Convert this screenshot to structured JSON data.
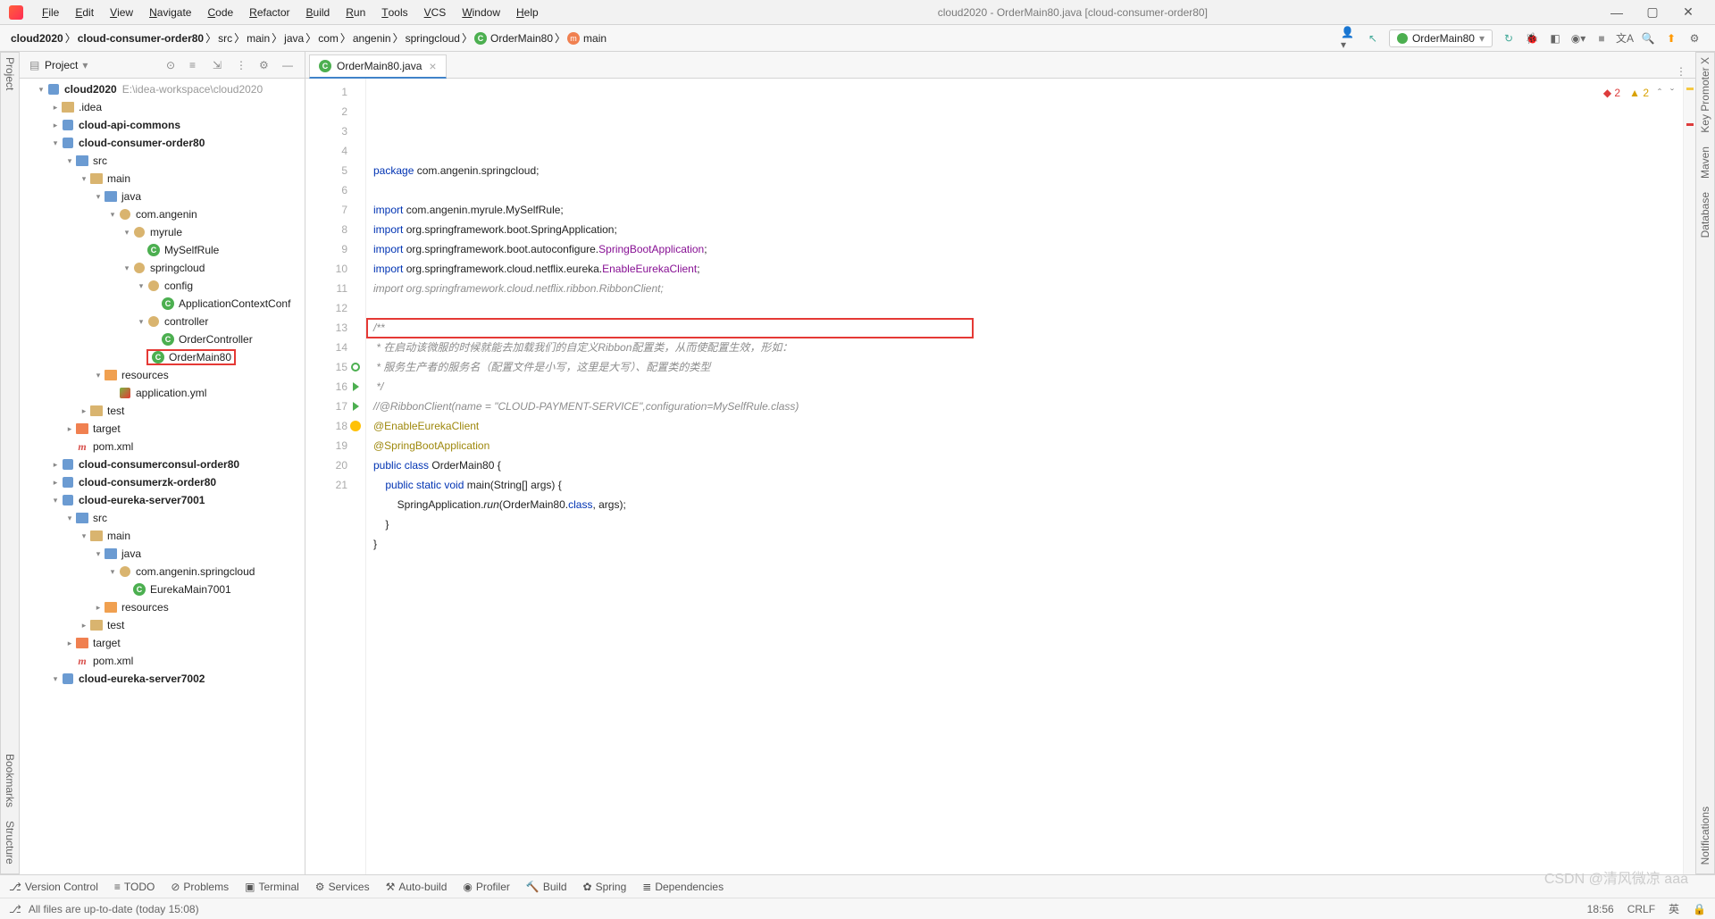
{
  "window": {
    "title": "cloud2020 - OrderMain80.java [cloud-consumer-order80]"
  },
  "menu": [
    "File",
    "Edit",
    "View",
    "Navigate",
    "Code",
    "Refactor",
    "Build",
    "Run",
    "Tools",
    "VCS",
    "Window",
    "Help"
  ],
  "breadcrumbs": [
    {
      "label": "cloud2020",
      "bold": true
    },
    {
      "label": "cloud-consumer-order80",
      "bold": true
    },
    {
      "label": "src"
    },
    {
      "label": "main"
    },
    {
      "label": "java"
    },
    {
      "label": "com"
    },
    {
      "label": "angenin"
    },
    {
      "label": "springcloud"
    },
    {
      "label": "OrderMain80",
      "icon": "class"
    },
    {
      "label": "main",
      "icon": "method"
    }
  ],
  "run_config": "OrderMain80",
  "project_panel": {
    "title": "Project"
  },
  "tree": [
    {
      "d": 0,
      "a": "v",
      "i": "module",
      "n": "cloud2020",
      "b": true,
      "p": "E:\\idea-workspace\\cloud2020"
    },
    {
      "d": 1,
      "a": ">",
      "i": "folder",
      "n": ".idea"
    },
    {
      "d": 1,
      "a": ">",
      "i": "module",
      "n": "cloud-api-commons",
      "b": true
    },
    {
      "d": 1,
      "a": "v",
      "i": "module",
      "n": "cloud-consumer-order80",
      "b": true
    },
    {
      "d": 2,
      "a": "v",
      "i": "folder-blue",
      "n": "src"
    },
    {
      "d": 3,
      "a": "v",
      "i": "folder",
      "n": "main"
    },
    {
      "d": 4,
      "a": "v",
      "i": "folder-blue",
      "n": "java"
    },
    {
      "d": 5,
      "a": "v",
      "i": "pkg",
      "n": "com.angenin"
    },
    {
      "d": 6,
      "a": "v",
      "i": "pkg",
      "n": "myrule"
    },
    {
      "d": 7,
      "a": "",
      "i": "class",
      "n": "MySelfRule"
    },
    {
      "d": 6,
      "a": "v",
      "i": "pkg",
      "n": "springcloud"
    },
    {
      "d": 7,
      "a": "v",
      "i": "pkg",
      "n": "config"
    },
    {
      "d": 8,
      "a": "",
      "i": "class",
      "n": "ApplicationContextConf"
    },
    {
      "d": 7,
      "a": "v",
      "i": "pkg",
      "n": "controller"
    },
    {
      "d": 8,
      "a": "",
      "i": "class",
      "n": "OrderController"
    },
    {
      "d": 7,
      "a": "",
      "i": "class",
      "n": "OrderMain80",
      "red": true
    },
    {
      "d": 4,
      "a": "v",
      "i": "folder-orange",
      "n": "resources"
    },
    {
      "d": 5,
      "a": "",
      "i": "yml",
      "n": "application.yml"
    },
    {
      "d": 3,
      "a": ">",
      "i": "folder",
      "n": "test"
    },
    {
      "d": 2,
      "a": ">",
      "i": "folder-excl",
      "n": "target"
    },
    {
      "d": 2,
      "a": "",
      "i": "mvn",
      "n": "pom.xml"
    },
    {
      "d": 1,
      "a": ">",
      "i": "module",
      "n": "cloud-consumerconsul-order80",
      "b": true
    },
    {
      "d": 1,
      "a": ">",
      "i": "module",
      "n": "cloud-consumerzk-order80",
      "b": true
    },
    {
      "d": 1,
      "a": "v",
      "i": "module",
      "n": "cloud-eureka-server7001",
      "b": true
    },
    {
      "d": 2,
      "a": "v",
      "i": "folder-blue",
      "n": "src"
    },
    {
      "d": 3,
      "a": "v",
      "i": "folder",
      "n": "main"
    },
    {
      "d": 4,
      "a": "v",
      "i": "folder-blue",
      "n": "java"
    },
    {
      "d": 5,
      "a": "v",
      "i": "pkg",
      "n": "com.angenin.springcloud"
    },
    {
      "d": 6,
      "a": "",
      "i": "class",
      "n": "EurekaMain7001"
    },
    {
      "d": 4,
      "a": ">",
      "i": "folder-orange",
      "n": "resources"
    },
    {
      "d": 3,
      "a": ">",
      "i": "folder",
      "n": "test"
    },
    {
      "d": 2,
      "a": ">",
      "i": "folder-excl",
      "n": "target"
    },
    {
      "d": 2,
      "a": "",
      "i": "mvn",
      "n": "pom.xml"
    },
    {
      "d": 1,
      "a": "v",
      "i": "module",
      "n": "cloud-eureka-server7002",
      "b": true
    }
  ],
  "tab": {
    "label": "OrderMain80.java"
  },
  "inspections": {
    "errors": "2",
    "warnings": "2"
  },
  "code_lines": [
    {
      "n": 1,
      "seg": [
        {
          "t": "package ",
          "c": "kw"
        },
        {
          "t": "com.angenin.springcloud;"
        }
      ]
    },
    {
      "n": 2,
      "seg": []
    },
    {
      "n": 3,
      "seg": [
        {
          "t": "import ",
          "c": "kw"
        },
        {
          "t": "com.angenin.myrule.MySelfRule;"
        }
      ]
    },
    {
      "n": 4,
      "seg": [
        {
          "t": "import ",
          "c": "kw"
        },
        {
          "t": "org.springframework.boot.SpringApplication;"
        }
      ]
    },
    {
      "n": 5,
      "seg": [
        {
          "t": "import ",
          "c": "kw"
        },
        {
          "t": "org.springframework.boot.autoconfigure."
        },
        {
          "t": "SpringBootApplication",
          "c": "used"
        },
        {
          "t": ";"
        }
      ]
    },
    {
      "n": 6,
      "seg": [
        {
          "t": "import ",
          "c": "kw"
        },
        {
          "t": "org.springframework.cloud.netflix.eureka."
        },
        {
          "t": "EnableEurekaClient",
          "c": "used"
        },
        {
          "t": ";"
        }
      ]
    },
    {
      "n": 7,
      "seg": [
        {
          "t": "import org.springframework.cloud.netflix.ribbon.RibbonClient;",
          "c": "com"
        }
      ]
    },
    {
      "n": 8,
      "seg": []
    },
    {
      "n": 9,
      "seg": [
        {
          "t": "/**",
          "c": "doc"
        }
      ]
    },
    {
      "n": 10,
      "seg": [
        {
          "t": " * 在启动该微服的时候就能去加载我们的自定义Ribbon配置类，从而使配置生效，形如：",
          "c": "doc"
        }
      ]
    },
    {
      "n": 11,
      "seg": [
        {
          "t": " * 服务生产者的服务名（配置文件是小写，这里是大写）、配置类的类型",
          "c": "doc"
        }
      ]
    },
    {
      "n": 12,
      "seg": [
        {
          "t": " */",
          "c": "doc"
        }
      ]
    },
    {
      "n": 13,
      "seg": [
        {
          "t": "//@RibbonClient(name = \"CLOUD-PAYMENT-SERVICE\",configuration=MySelfRule.class)",
          "c": "com"
        }
      ]
    },
    {
      "n": 14,
      "seg": [
        {
          "t": "@EnableEurekaClient",
          "c": "ann"
        }
      ]
    },
    {
      "n": 15,
      "seg": [
        {
          "t": "@SpringBootApplication",
          "c": "ann"
        }
      ]
    },
    {
      "n": 16,
      "seg": [
        {
          "t": "public class ",
          "c": "kw"
        },
        {
          "t": "OrderMain80"
        },
        {
          "t": " {"
        }
      ]
    },
    {
      "n": 17,
      "seg": [
        {
          "t": "    "
        },
        {
          "t": "public static void ",
          "c": "kw"
        },
        {
          "t": "main"
        },
        {
          "t": "(String[] args) {"
        }
      ]
    },
    {
      "n": 18,
      "seg": [
        {
          "t": "        SpringApplication."
        },
        {
          "t": "run",
          "c": "mtd"
        },
        {
          "t": "(OrderMain80."
        },
        {
          "t": "class",
          "c": "kw"
        },
        {
          "t": ", args);"
        }
      ]
    },
    {
      "n": 19,
      "seg": [
        {
          "t": "    }"
        }
      ]
    },
    {
      "n": 20,
      "seg": [
        {
          "t": "}"
        }
      ]
    },
    {
      "n": 21,
      "seg": []
    }
  ],
  "gutter_marks": {
    "15": "circle-green",
    "16": "triangle-green",
    "17": "triangle-green",
    "18": "bulb"
  },
  "left_tools": [
    "Project",
    "Bookmarks",
    "Structure"
  ],
  "right_tools": [
    "Key Promoter X",
    "Maven",
    "Database",
    "Notifications"
  ],
  "bottom_tools": [
    {
      "i": "⎇",
      "l": "Version Control"
    },
    {
      "i": "≡",
      "l": "TODO"
    },
    {
      "i": "⊘",
      "l": "Problems"
    },
    {
      "i": "▣",
      "l": "Terminal"
    },
    {
      "i": "⚙",
      "l": "Services"
    },
    {
      "i": "⚒",
      "l": "Auto-build"
    },
    {
      "i": "◉",
      "l": "Profiler"
    },
    {
      "i": "🔨",
      "l": "Build"
    },
    {
      "i": "✿",
      "l": "Spring"
    },
    {
      "i": "≣",
      "l": "Dependencies"
    }
  ],
  "status": {
    "msg": "All files are up-to-date (today 15:08)",
    "time": "18:56",
    "enc": "CRLF",
    "lang": "英"
  },
  "watermark": "CSDN @清风微凉 aaa"
}
